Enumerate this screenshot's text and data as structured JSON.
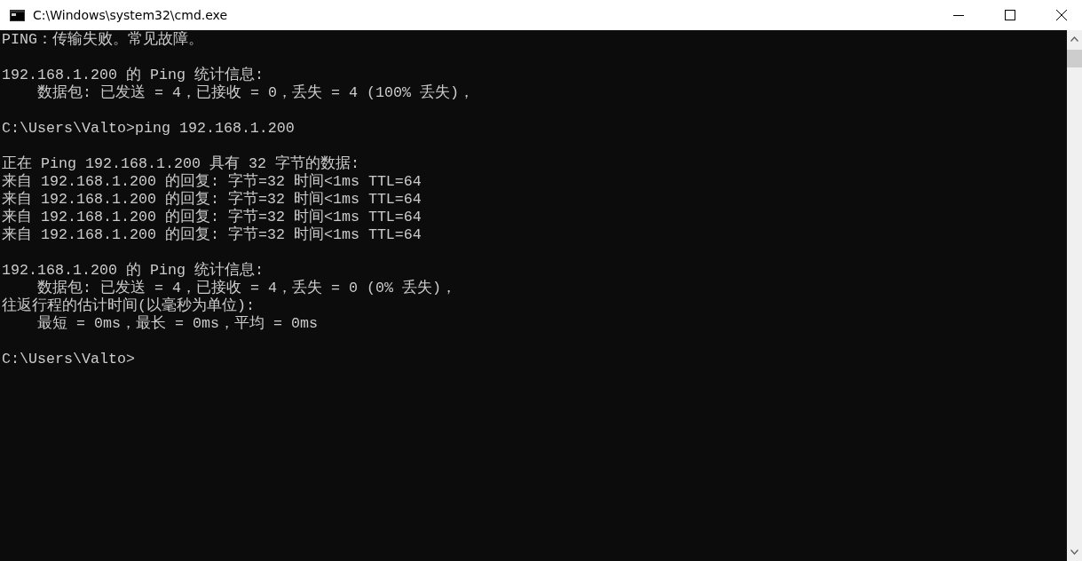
{
  "window": {
    "title": "C:\\Windows\\system32\\cmd.exe"
  },
  "console": {
    "blocks": [
      [
        {
          "kind": "plain",
          "text": "PING：传输失败。常见故障。"
        }
      ],
      [
        {
          "kind": "plain",
          "text": "192.168.1.200 的 Ping 统计信息:"
        },
        {
          "kind": "indented",
          "text": "数据包: 已发送 = 4，已接收 = 0，丢失 = 4 (100% 丢失)，"
        }
      ],
      [
        {
          "kind": "plain",
          "text": "C:\\Users\\Valto>ping 192.168.1.200"
        }
      ],
      [
        {
          "kind": "plain",
          "text": "正在 Ping 192.168.1.200 具有 32 字节的数据:"
        },
        {
          "kind": "plain",
          "text": "来自 192.168.1.200 的回复: 字节=32 时间<1ms TTL=64"
        },
        {
          "kind": "plain",
          "text": "来自 192.168.1.200 的回复: 字节=32 时间<1ms TTL=64"
        },
        {
          "kind": "plain",
          "text": "来自 192.168.1.200 的回复: 字节=32 时间<1ms TTL=64"
        },
        {
          "kind": "plain",
          "text": "来自 192.168.1.200 的回复: 字节=32 时间<1ms TTL=64"
        }
      ],
      [
        {
          "kind": "plain",
          "text": "192.168.1.200 的 Ping 统计信息:"
        },
        {
          "kind": "indented",
          "text": "数据包: 已发送 = 4，已接收 = 4，丢失 = 0 (0% 丢失)，"
        },
        {
          "kind": "plain",
          "text": "往返行程的估计时间(以毫秒为单位):"
        },
        {
          "kind": "indented",
          "text": "最短 = 0ms，最长 = 0ms，平均 = 0ms"
        }
      ],
      [
        {
          "kind": "plain",
          "text": "C:\\Users\\Valto>"
        }
      ]
    ]
  }
}
